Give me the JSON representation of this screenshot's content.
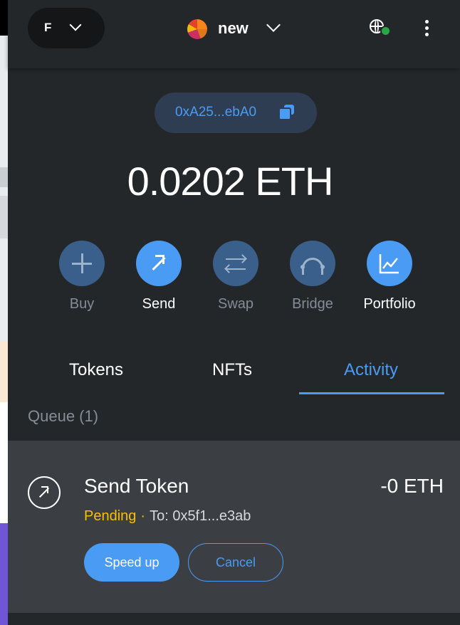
{
  "header": {
    "account_initial": "F",
    "network_name": "new"
  },
  "address": {
    "short": "0xA25...ebA0"
  },
  "balance": {
    "amount": "0.0202",
    "unit": "ETH"
  },
  "actions": [
    {
      "label": "Buy",
      "icon": "plus-icon",
      "enabled": false
    },
    {
      "label": "Send",
      "icon": "arrow-up-right-icon",
      "enabled": true
    },
    {
      "label": "Swap",
      "icon": "swap-icon",
      "enabled": false
    },
    {
      "label": "Bridge",
      "icon": "bridge-icon",
      "enabled": false
    },
    {
      "label": "Portfolio",
      "icon": "chart-icon",
      "enabled": true
    }
  ],
  "tabs": [
    {
      "label": "Tokens",
      "active": false
    },
    {
      "label": "NFTs",
      "active": false
    },
    {
      "label": "Activity",
      "active": true
    }
  ],
  "queue": {
    "label": "Queue (1)"
  },
  "activity": {
    "title": "Send Token",
    "amount": "-0 ETH",
    "status": "Pending",
    "separator": "·",
    "recipient": "To: 0x5f1...e3ab",
    "speed_up_label": "Speed up",
    "cancel_label": "Cancel"
  },
  "colors": {
    "background": "#24272a",
    "accent": "#4a9bf4",
    "pending": "#f8c000",
    "row_background": "#3b3f44"
  }
}
